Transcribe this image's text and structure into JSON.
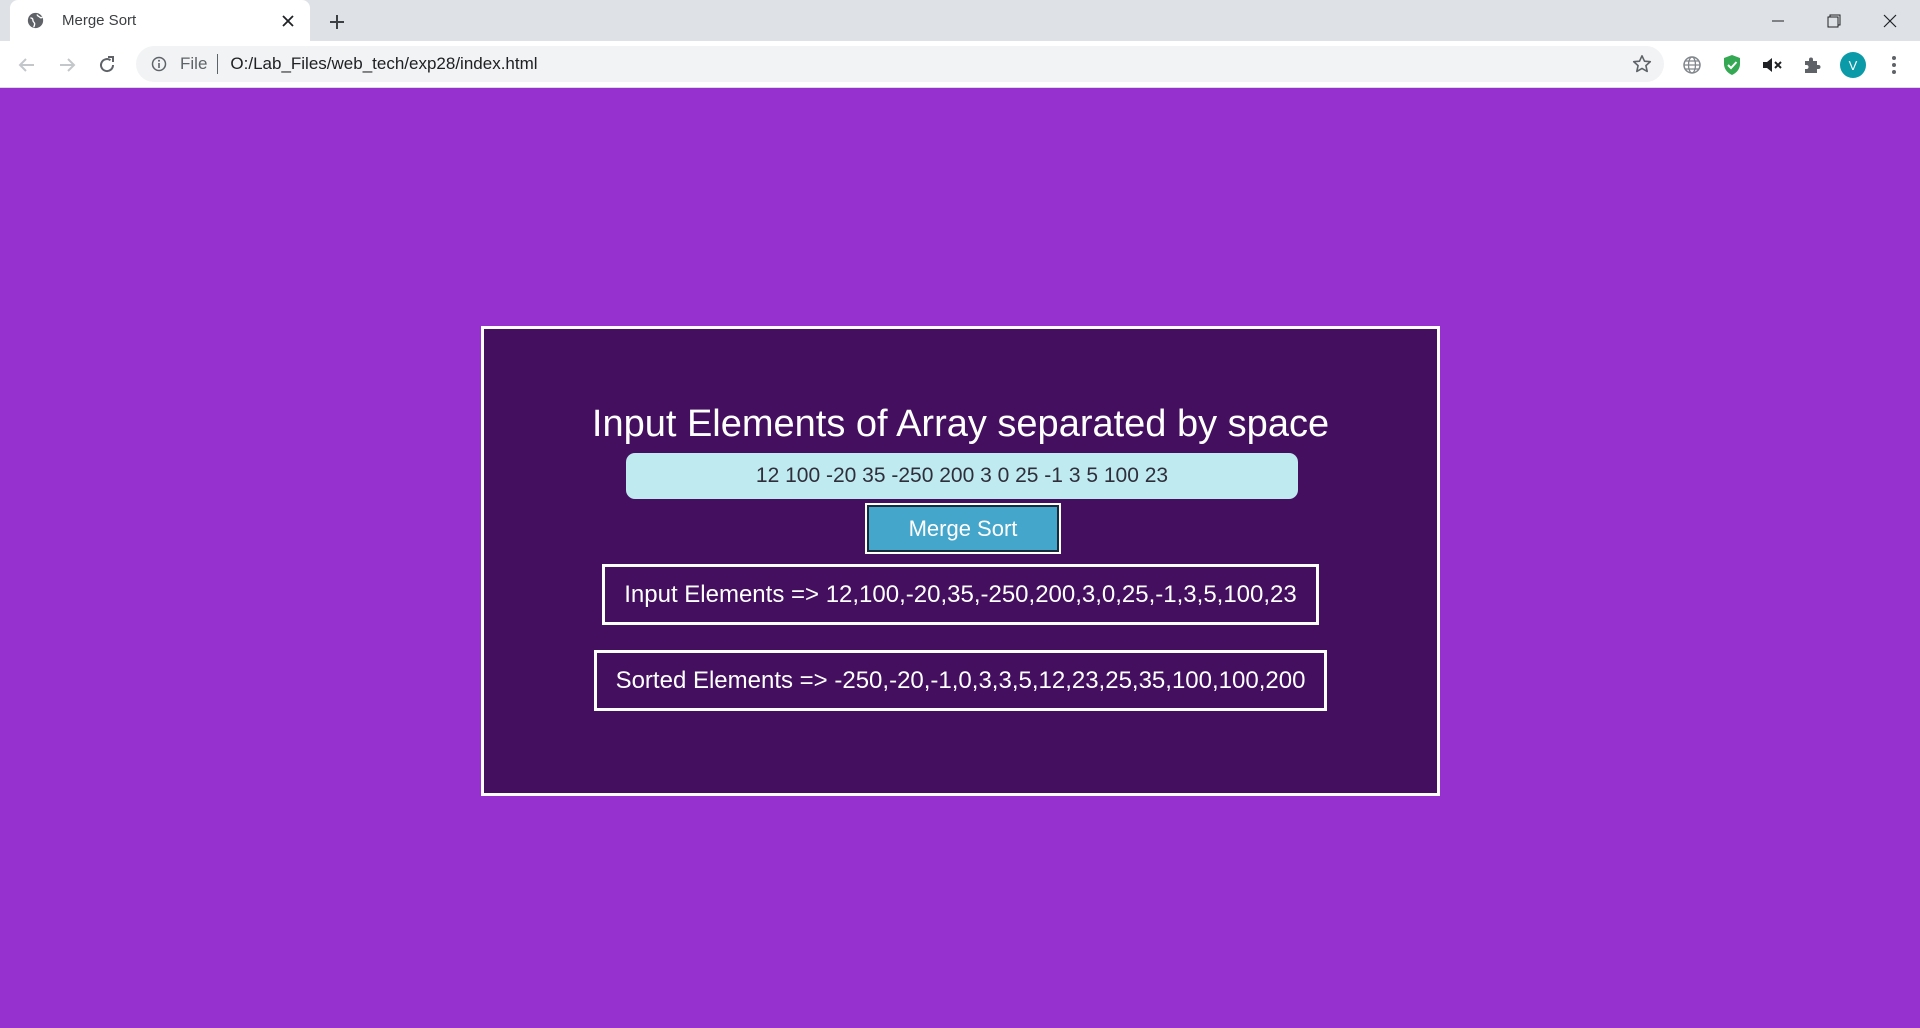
{
  "browser": {
    "tab": {
      "title": "Merge Sort"
    },
    "address_bar": {
      "scheme_label": "File",
      "url": "O:/Lab_Files/web_tech/exp28/index.html"
    },
    "profile_initial": "V"
  },
  "page": {
    "heading": "Input Elements of Array separated by space",
    "array_input_value": "12 100 -20 35 -250 200 3 0 25 -1 3 5 100 23",
    "sort_button_label": "Merge Sort",
    "input_result": "Input Elements => 12,100,-20,35,-250,200,3,0,25,-1,3,5,100,23",
    "sorted_result": "Sorted Elements => -250,-20,-1,0,3,3,5,12,23,25,35,100,100,200"
  },
  "colors": {
    "page_background": "#9630cf",
    "card_background": "#430f5e",
    "input_background": "#bfeaf0",
    "button_background": "#45a6cc"
  }
}
